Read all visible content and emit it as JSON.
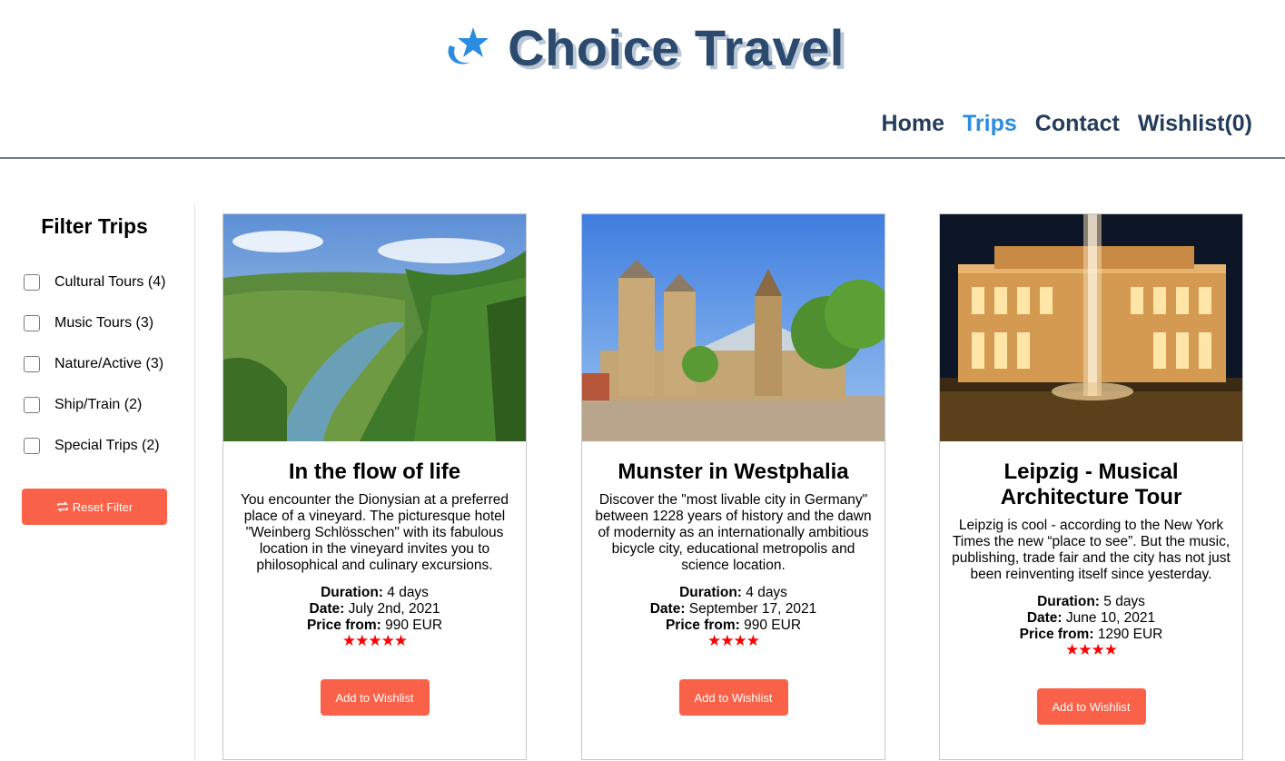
{
  "header": {
    "title": "Choice Travel",
    "nav": [
      {
        "label": "Home",
        "active": false
      },
      {
        "label": "Trips",
        "active": true
      },
      {
        "label": "Contact",
        "active": false
      },
      {
        "label": "Wishlist(0)",
        "active": false
      }
    ]
  },
  "sidebar": {
    "title": "Filter Trips",
    "filters": [
      {
        "label": "Cultural Tours (4)",
        "checked": false
      },
      {
        "label": "Music Tours (3)",
        "checked": false
      },
      {
        "label": "Nature/Active (3)",
        "checked": false
      },
      {
        "label": "Ship/Train (2)",
        "checked": false
      },
      {
        "label": "Special Trips (2)",
        "checked": false
      }
    ],
    "reset_label": "Reset Filter"
  },
  "labels": {
    "duration": "Duration:",
    "date": "Date:",
    "price": "Price from:",
    "wishlist_button": "Add to Wishlist"
  },
  "trips": [
    {
      "title": "In the flow of life",
      "description": "You encounter the Dionysian at a preferred place of a vineyard. The picturesque hotel \"Weinberg Schlösschen\" with its fabulous location in the vineyard invites you to philosophical and culinary excursions.",
      "duration": "4 days",
      "date": "July 2nd, 2021",
      "price": "990 EUR",
      "rating": 5
    },
    {
      "title": "Munster in Westphalia",
      "description": "Discover the \"most livable city in Germany\" between 1228 years of history and the dawn of modernity as an internationally ambitious bicycle city, educational metropolis and science location.",
      "duration": "4 days",
      "date": "September 17, 2021",
      "price": "990 EUR",
      "rating": 4
    },
    {
      "title": "Leipzig - Musical Architecture Tour",
      "description": "Leipzig is cool - according to the New York Times the new “place to see”. But the music, publishing, trade fair and the city has not just been reinventing itself since yesterday.",
      "duration": "5 days",
      "date": "June 10, 2021",
      "price": "1290 EUR",
      "rating": 4
    }
  ],
  "colors": {
    "brand": "#2c4a6e",
    "nav_active": "#2b8ce0",
    "button": "#f96148",
    "star": "#ff0000"
  }
}
